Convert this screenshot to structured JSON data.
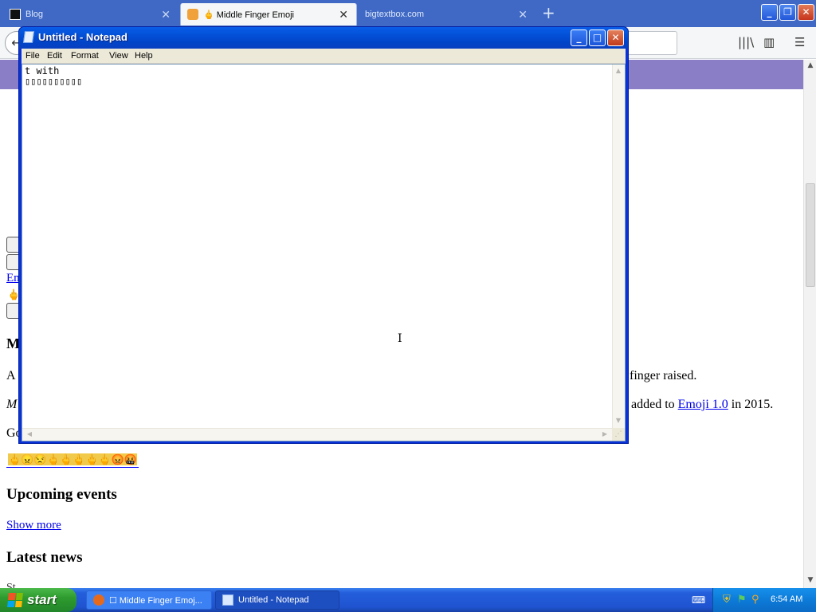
{
  "browser": {
    "tabs": [
      {
        "label": "Blog",
        "close": "✕"
      },
      {
        "label": "🖕 Middle Finger Emoji",
        "close": "✕"
      },
      {
        "label": "bigtextbox.com",
        "close": "✕"
      }
    ],
    "new_tab": "+",
    "window_buttons": {
      "minimize": "_",
      "maximize": "❐",
      "close": "✕"
    },
    "nav": {
      "back": "←",
      "library_icon": "|||\\",
      "sidebar_icon": "▥",
      "menu_icon": "☰"
    }
  },
  "page": {
    "link_em": "En",
    "hand_glyph": "🖕",
    "heading_m": "M",
    "text_a": "A",
    "text_finger": "finger raised.",
    "text_m": "M",
    "text_added_before": "added to ",
    "text_added_link": "Emoji 1.0",
    "text_added_after": " in 2015.",
    "text_go": "Go",
    "emoji_strip": "🖕😠😒🖕🖕🖕🖕🖕😡🤬",
    "heading_upcoming": "Upcoming events",
    "link_show_more": "Show more",
    "heading_latest": "Latest news",
    "cut_text": "St"
  },
  "notepad": {
    "title": "Untitled - Notepad",
    "menus": [
      "File",
      "Edit",
      "Format",
      "View",
      "Help"
    ],
    "content_line1": "t with",
    "content_line2": "▯▯▯▯▯▯▯▯▯▯",
    "window_buttons": {
      "minimize": "_",
      "maximize": "□",
      "close": "✕"
    }
  },
  "taskbar": {
    "start_label": "start",
    "tasks": [
      {
        "label": "☐ Middle Finger Emoj..."
      },
      {
        "label": "Untitled - Notepad"
      }
    ],
    "clock": "6:54 AM"
  },
  "colors": {
    "firefox_tab_bar": "#3f69c5",
    "page_band": "#8a7fc6",
    "xp_title_blue": "#0453db",
    "xp_start_green": "#2e9b2e",
    "link_blue": "#0000ee"
  }
}
